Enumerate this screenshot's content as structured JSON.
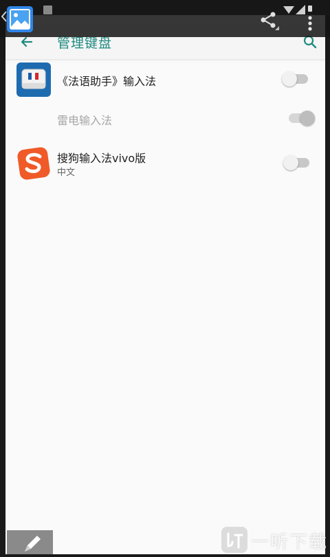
{
  "app_bar": {
    "title": "管理键盘"
  },
  "keyboards": [
    {
      "name": "《法语助手》输入法",
      "subtitle": "",
      "enabled": false,
      "disabled": false,
      "icon": "french-assistant-keyboard-icon"
    },
    {
      "name": "雷电输入法",
      "subtitle": "",
      "enabled": true,
      "disabled": true,
      "icon": ""
    },
    {
      "name": "搜狗输入法vivo版",
      "subtitle": "中文",
      "enabled": false,
      "disabled": false,
      "icon": "sogou-icon"
    }
  ],
  "watermark": {
    "text": "一听下载"
  },
  "colors": {
    "accent": "#1e8a80",
    "background": "#fafafa",
    "sogou": "#f05a28",
    "french_icon_bg": "#1e6bb0"
  }
}
